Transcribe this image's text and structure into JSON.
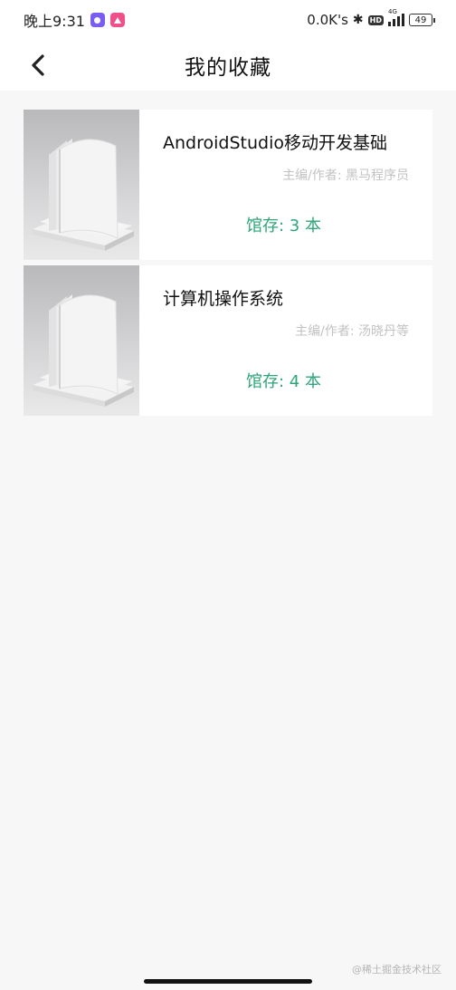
{
  "status_bar": {
    "time": "晚上9:31",
    "net_speed": "0.0K's",
    "network_type": "4G",
    "hd_label": "HD",
    "battery": "49"
  },
  "header": {
    "title": "我的收藏"
  },
  "favorites": [
    {
      "title": "AndroidStudio移动开发基础",
      "author": "主编/作者: 黑马程序员",
      "stock": "馆存: 3 本"
    },
    {
      "title": "计算机操作系统",
      "author": "主编/作者: 汤晓丹等",
      "stock": "馆存: 4 本"
    }
  ],
  "watermark": "@稀土掘金技术社区",
  "colors": {
    "accent_green": "#2ea57a",
    "background": "#f7f7f7",
    "card": "#ffffff"
  }
}
